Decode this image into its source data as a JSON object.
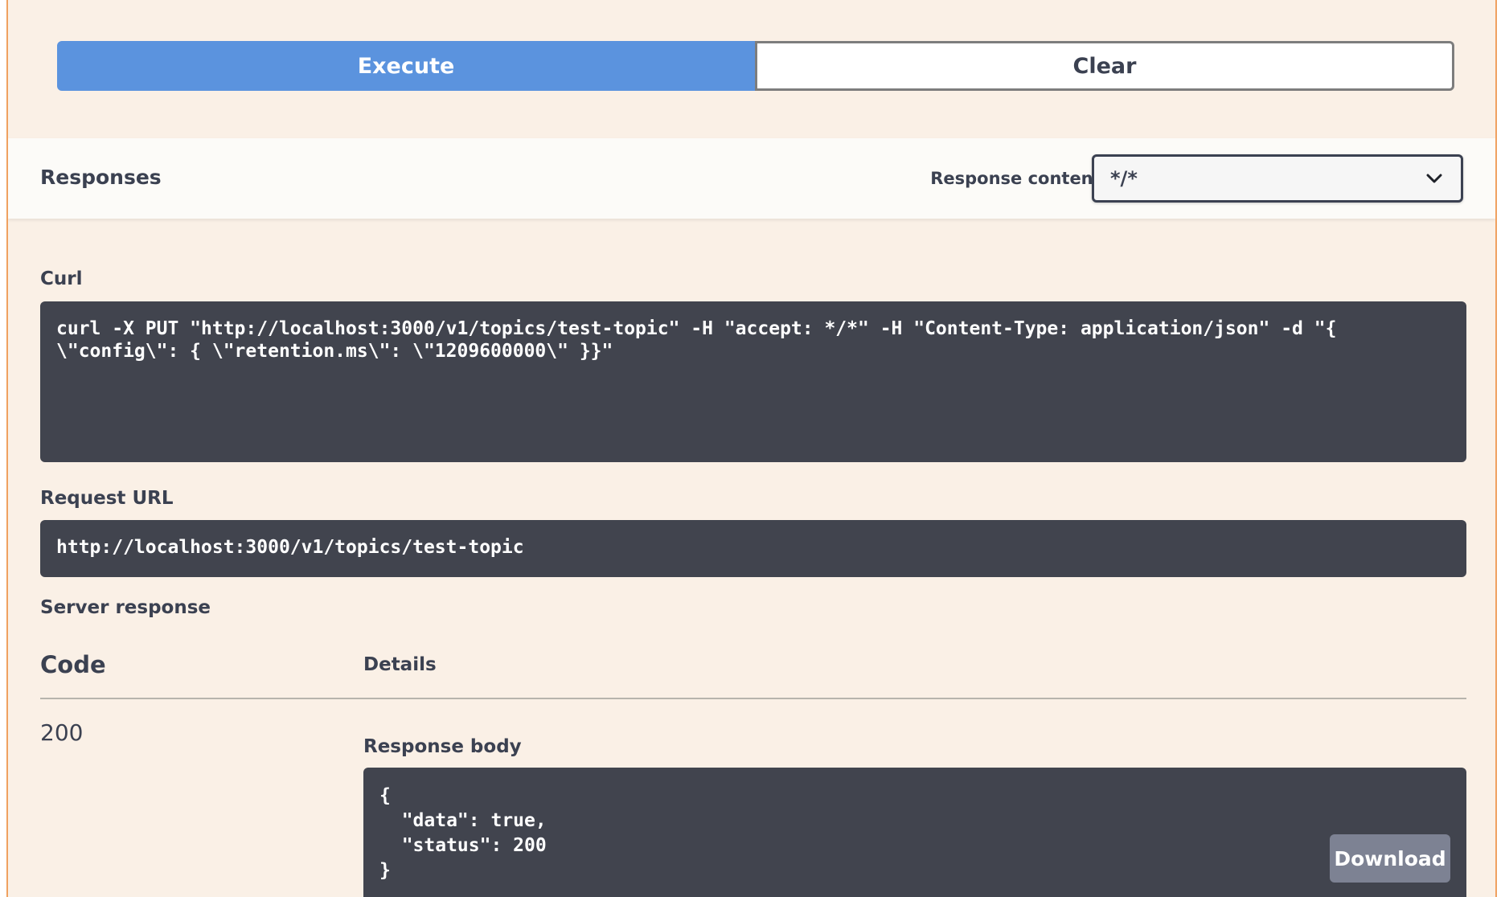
{
  "actions": {
    "execute_label": "Execute",
    "clear_label": "Clear"
  },
  "responses": {
    "title": "Responses",
    "content_type_label": "Response content type",
    "content_type_value": "*/*"
  },
  "curl": {
    "label": "Curl",
    "command": "curl -X PUT \"http://localhost:3000/v1/topics/test-topic\" -H \"accept: */*\" -H \"Content-Type: application/json\" -d \"{\n\\\"config\\\": { \\\"retention.ms\\\": \\\"1209600000\\\" }}\""
  },
  "request_url": {
    "label": "Request URL",
    "value": "http://localhost:3000/v1/topics/test-topic"
  },
  "server_response": {
    "label": "Server response",
    "code_header": "Code",
    "details_header": "Details",
    "code": "200",
    "body_label": "Response body",
    "body": "{\n  \"data\": true,\n  \"status\": 200\n}",
    "download_label": "Download"
  },
  "colors": {
    "execute": "#5b93de",
    "code_bg": "#41444e",
    "page_bg": "#faf0e6",
    "border_accent": "#f0a160"
  }
}
